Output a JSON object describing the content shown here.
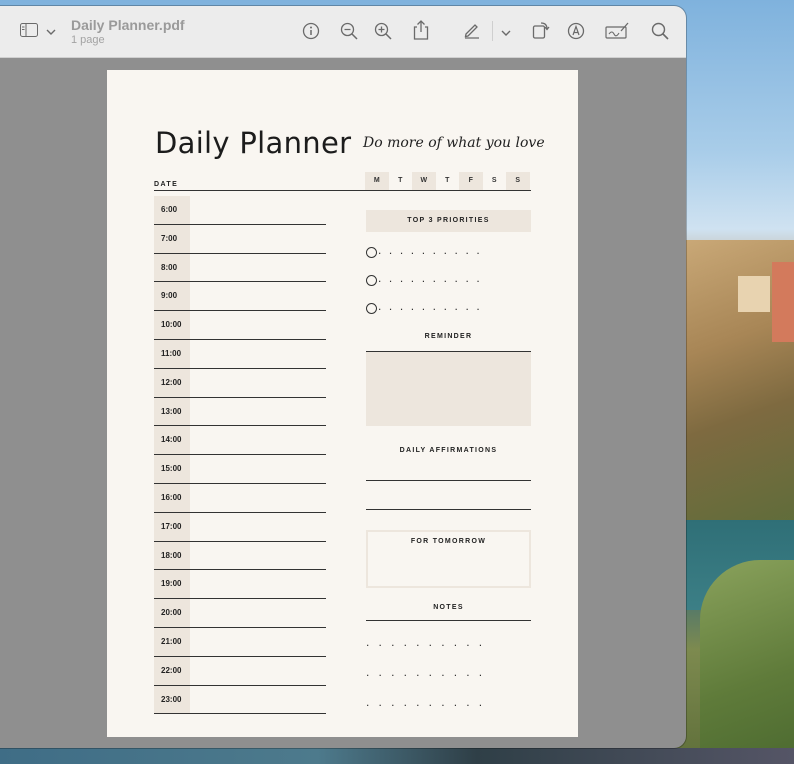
{
  "window": {
    "title": "Daily Planner.pdf",
    "subtitle": "1 page"
  },
  "toolbar": {
    "icons": [
      "sidebar-icon",
      "chevron-down-icon",
      "info-icon",
      "zoom-out-icon",
      "zoom-in-icon",
      "share-icon",
      "markup-pen-icon",
      "chevron-down-icon",
      "rotate-icon",
      "annotate-icon",
      "signature-icon",
      "search-icon"
    ]
  },
  "planner": {
    "title": "Daily Planner",
    "script_tagline": "Do more of what you love",
    "date_label": "DATE",
    "days": [
      {
        "label": "M",
        "shaded": true
      },
      {
        "label": "T",
        "shaded": false
      },
      {
        "label": "W",
        "shaded": true
      },
      {
        "label": "T",
        "shaded": false
      },
      {
        "label": "F",
        "shaded": true
      },
      {
        "label": "S",
        "shaded": false
      },
      {
        "label": "S",
        "shaded": true
      }
    ],
    "times": [
      "6:00",
      "7:00",
      "8:00",
      "9:00",
      "10:00",
      "11:00",
      "12:00",
      "13:00",
      "14:00",
      "15:00",
      "16:00",
      "17:00",
      "18:00",
      "19:00",
      "20:00",
      "21:00",
      "22:00",
      "23:00"
    ],
    "priorities_heading": "TOP 3 PRIORITIES",
    "reminder_heading": "REMINDER",
    "affirmations_heading": "DAILY AFFIRMATIONS",
    "tomorrow_heading": "FOR TOMORROW",
    "notes_heading": "NOTES",
    "accent_color": "#ede6dd",
    "page_color": "#f9f6f1"
  }
}
